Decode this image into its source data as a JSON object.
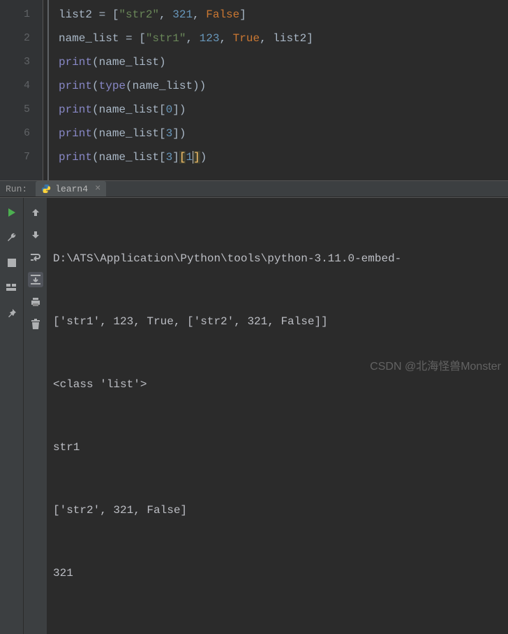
{
  "code": {
    "lines": [
      {
        "n": "1"
      },
      {
        "n": "2"
      },
      {
        "n": "3"
      },
      {
        "n": "4"
      },
      {
        "n": "5"
      },
      {
        "n": "6"
      },
      {
        "n": "7"
      }
    ],
    "l1": {
      "a": "list2 = [",
      "s1": "\"str2\"",
      "c1": ", ",
      "n1": "321",
      "c2": ", ",
      "k1": "False",
      "z": "]"
    },
    "l2": {
      "a": "name_list = [",
      "s1": "\"str1\"",
      "c1": ", ",
      "n1": "123",
      "c2": ", ",
      "k1": "True",
      "c3": ", list2]"
    },
    "l3": {
      "fn": "print",
      "p": "(name_list)"
    },
    "l4": {
      "fn1": "print",
      "p1": "(",
      "fn2": "type",
      "p2": "(name_list))"
    },
    "l5": {
      "fn": "print",
      "p1": "(name_list[",
      "n": "0",
      "p2": "])"
    },
    "l6": {
      "fn": "print",
      "p1": "(name_list[",
      "n": "3",
      "p2": "])"
    },
    "l7": {
      "fn": "print",
      "p1": "(name_list[",
      "n1": "3",
      "p2": "]",
      "b1": "[",
      "n2": "1",
      "b2": "]",
      "p3": ")"
    }
  },
  "run": {
    "label": "Run:",
    "tab_name": "learn4",
    "output": [
      "D:\\ATS\\Application\\Python\\tools\\python-3.11.0-embed-",
      "['str1', 123, True, ['str2', 321, False]]",
      "<class 'list'>",
      "str1",
      "['str2', 321, False]",
      "321"
    ]
  },
  "watermark": "CSDN @北海怪兽Monster"
}
